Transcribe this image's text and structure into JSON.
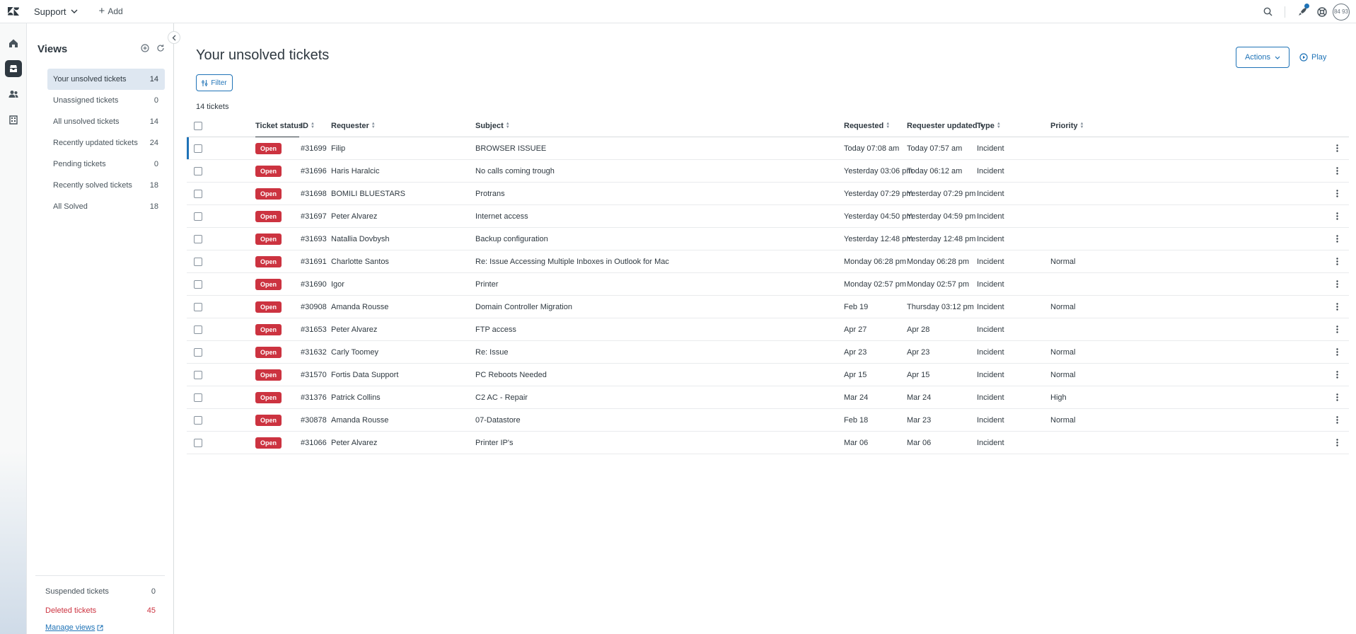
{
  "topbar": {
    "product": "Support",
    "add_label": "Add",
    "avatar_text": "84 93"
  },
  "views_panel": {
    "title": "Views",
    "items": [
      {
        "label": "Your unsolved tickets",
        "count": "14"
      },
      {
        "label": "Unassigned tickets",
        "count": "0"
      },
      {
        "label": "All unsolved tickets",
        "count": "14"
      },
      {
        "label": "Recently updated tickets",
        "count": "24"
      },
      {
        "label": "Pending tickets",
        "count": "0"
      },
      {
        "label": "Recently solved tickets",
        "count": "18"
      },
      {
        "label": "All Solved",
        "count": "18"
      }
    ],
    "suspended": {
      "label": "Suspended tickets",
      "count": "0"
    },
    "deleted": {
      "label": "Deleted tickets",
      "count": "45"
    },
    "manage_label": "Manage views"
  },
  "main": {
    "title": "Your unsolved tickets",
    "actions_label": "Actions",
    "play_label": "Play",
    "filter_label": "Filter",
    "count_text": "14 tickets",
    "columns": {
      "status": "Ticket status",
      "id": "ID",
      "requester": "Requester",
      "subject": "Subject",
      "requested": "Requested",
      "requester_updated": "Requester updated",
      "type": "Type",
      "priority": "Priority"
    },
    "rows": [
      {
        "status": "Open",
        "id": "#31699",
        "requester": "Filip",
        "subject": "BROWSER ISSUEE",
        "requested": "Today 07:08 am",
        "updated": "Today 07:57 am",
        "type": "Incident",
        "priority": ""
      },
      {
        "status": "Open",
        "id": "#31696",
        "requester": "Haris Haralcic",
        "subject": "No calls coming trough",
        "requested": "Yesterday 03:06 pm",
        "updated": "Today 06:12 am",
        "type": "Incident",
        "priority": ""
      },
      {
        "status": "Open",
        "id": "#31698",
        "requester": "BOMILI BLUESTARS",
        "subject": "Protrans",
        "requested": "Yesterday 07:29 pm",
        "updated": "Yesterday 07:29 pm",
        "type": "Incident",
        "priority": ""
      },
      {
        "status": "Open",
        "id": "#31697",
        "requester": "Peter Alvarez",
        "subject": "Internet access",
        "requested": "Yesterday 04:50 pm",
        "updated": "Yesterday 04:59 pm",
        "type": "Incident",
        "priority": ""
      },
      {
        "status": "Open",
        "id": "#31693",
        "requester": "Natallia Dovbysh",
        "subject": "Backup configuration",
        "requested": "Yesterday 12:48 pm",
        "updated": "Yesterday 12:48 pm",
        "type": "Incident",
        "priority": ""
      },
      {
        "status": "Open",
        "id": "#31691",
        "requester": "Charlotte Santos",
        "subject": "Re: Issue Accessing Multiple Inboxes in Outlook for Mac",
        "requested": "Monday 06:28 pm",
        "updated": "Monday 06:28 pm",
        "type": "Incident",
        "priority": "Normal"
      },
      {
        "status": "Open",
        "id": "#31690",
        "requester": "Igor",
        "subject": "Printer",
        "requested": "Monday 02:57 pm",
        "updated": "Monday 02:57 pm",
        "type": "Incident",
        "priority": ""
      },
      {
        "status": "Open",
        "id": "#30908",
        "requester": "Amanda Rousse",
        "subject": "Domain Controller Migration",
        "requested": "Feb 19",
        "updated": "Thursday 03:12 pm",
        "type": "Incident",
        "priority": "Normal"
      },
      {
        "status": "Open",
        "id": "#31653",
        "requester": "Peter Alvarez",
        "subject": "FTP access",
        "requested": "Apr 27",
        "updated": "Apr 28",
        "type": "Incident",
        "priority": ""
      },
      {
        "status": "Open",
        "id": "#31632",
        "requester": "Carly Toomey",
        "subject": "Re: Issue",
        "requested": "Apr 23",
        "updated": "Apr 23",
        "type": "Incident",
        "priority": "Normal"
      },
      {
        "status": "Open",
        "id": "#31570",
        "requester": "Fortis Data Support",
        "subject": "PC Reboots Needed",
        "requested": "Apr 15",
        "updated": "Apr 15",
        "type": "Incident",
        "priority": "Normal"
      },
      {
        "status": "Open",
        "id": "#31376",
        "requester": "Patrick Collins",
        "subject": "C2 AC - Repair",
        "requested": "Mar 24",
        "updated": "Mar 24",
        "type": "Incident",
        "priority": "High"
      },
      {
        "status": "Open",
        "id": "#30878",
        "requester": "Amanda Rousse",
        "subject": "07-Datastore",
        "requested": "Feb 18",
        "updated": "Mar 23",
        "type": "Incident",
        "priority": "Normal"
      },
      {
        "status": "Open",
        "id": "#31066",
        "requester": "Peter Alvarez",
        "subject": "Printer IP's",
        "requested": "Mar 06",
        "updated": "Mar 06",
        "type": "Incident",
        "priority": ""
      }
    ]
  },
  "colors": {
    "accent": "#1f73b7",
    "open_badge": "#cc3340",
    "active_view": "#dee7f1"
  }
}
